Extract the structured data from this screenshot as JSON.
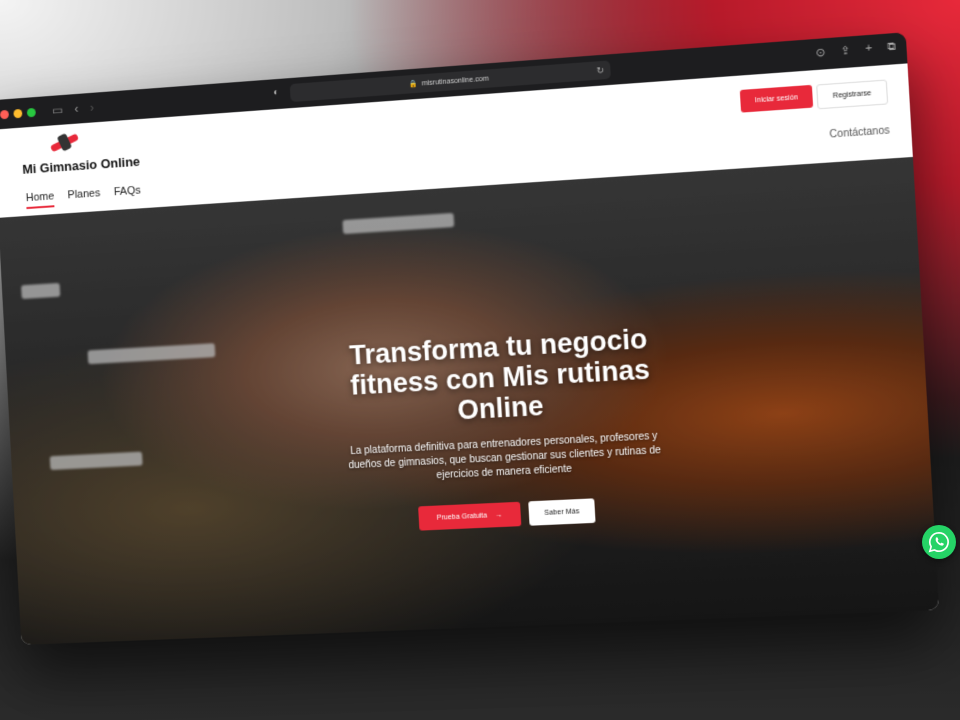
{
  "browser": {
    "url": "misrutinasonline.com"
  },
  "header": {
    "brand": "Mi Gimnasio Online",
    "login_label": "Iniciar sesión",
    "register_label": "Registrarse"
  },
  "nav": {
    "items": [
      {
        "label": "Home"
      },
      {
        "label": "Planes"
      },
      {
        "label": "FAQs"
      }
    ],
    "contact_label": "Contáctanos"
  },
  "hero": {
    "title": "Transforma tu negocio fitness con Mis rutinas Online",
    "subtitle": "La plataforma definitiva para entrenadores personales, profesores y dueños de gimnasios, que buscan gestionar sus clientes y rutinas de ejercicios de manera eficiente",
    "cta_primary": "Prueba Gratuita",
    "cta_secondary": "Saber Más"
  },
  "icons": {
    "floating": "whatsapp-icon"
  },
  "colors": {
    "accent": "#e8293a",
    "whatsapp": "#25d366"
  }
}
